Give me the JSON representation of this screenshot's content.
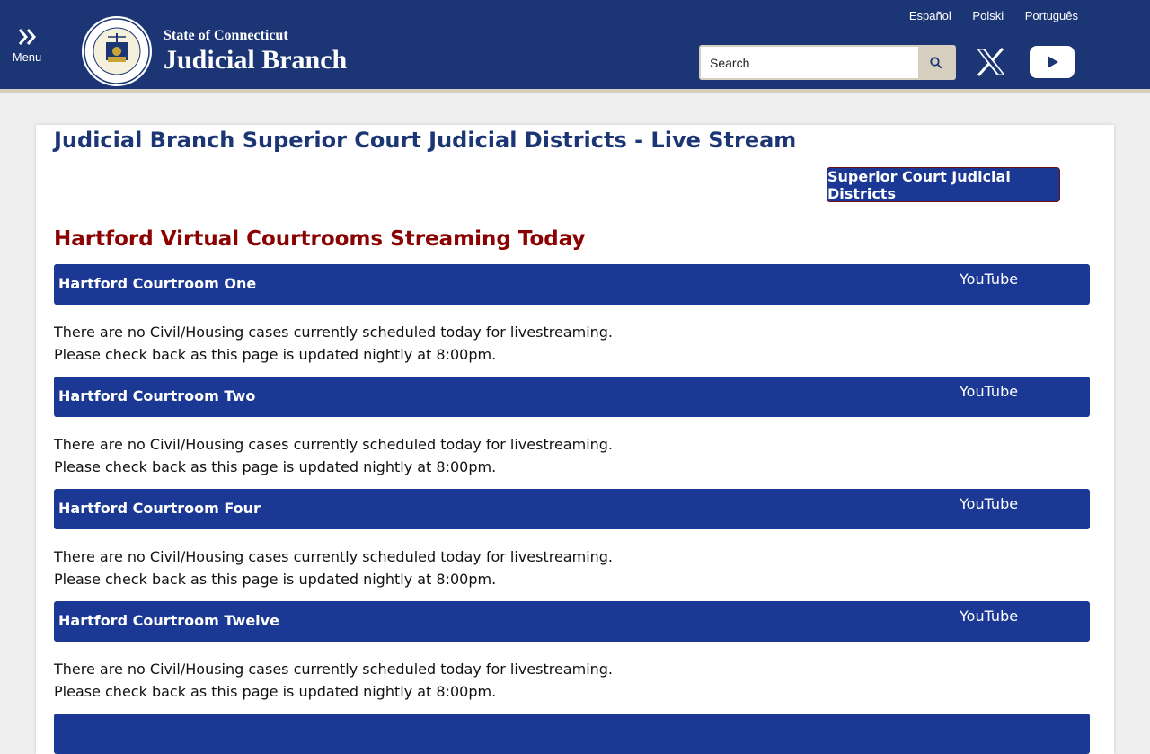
{
  "header": {
    "menu_label": "Menu",
    "brand_small": "State of Connecticut",
    "brand_large": "Judicial Branch",
    "languages": [
      "Español",
      "Polski",
      "Português"
    ],
    "search_placeholder": "Search",
    "seal_text": [
      "STATE OF CONNECTICUT",
      "JUDICIAL BRANCH"
    ]
  },
  "main": {
    "page_title": "Judicial Branch Superior Court Judicial Districts - Live Stream",
    "districts_button": "Superior Court Judicial Districts",
    "section_title": "Hartford Virtual Courtrooms Streaming Today",
    "youtube_label": "YouTube",
    "courtrooms": [
      {
        "name": "Hartford Courtroom One",
        "message_line1": "There are no Civil/Housing cases currently scheduled today for livestreaming.",
        "message_line2": "Please check back as this page is updated nightly at 8:00pm."
      },
      {
        "name": "Hartford Courtroom Two",
        "message_line1": "There are no Civil/Housing cases currently scheduled today for livestreaming.",
        "message_line2": "Please check back as this page is updated nightly at 8:00pm."
      },
      {
        "name": "Hartford Courtroom Four",
        "message_line1": "There are no Civil/Housing cases currently scheduled today for livestreaming.",
        "message_line2": "Please check back as this page is updated nightly at 8:00pm."
      },
      {
        "name": "Hartford Courtroom Twelve",
        "message_line1": "There are no Civil/Housing cases currently scheduled today for livestreaming.",
        "message_line2": "Please check back as this page is updated nightly at 8:00pm."
      }
    ]
  },
  "colors": {
    "header_bg": "#1c3675",
    "accent_tan": "#d6cfc0",
    "court_bar": "#1a3894",
    "section_title": "#8b0000"
  },
  "icons": {
    "menu": "double-chevron-right-icon",
    "search": "search-icon",
    "x": "x-logo-icon",
    "youtube": "youtube-play-icon"
  }
}
